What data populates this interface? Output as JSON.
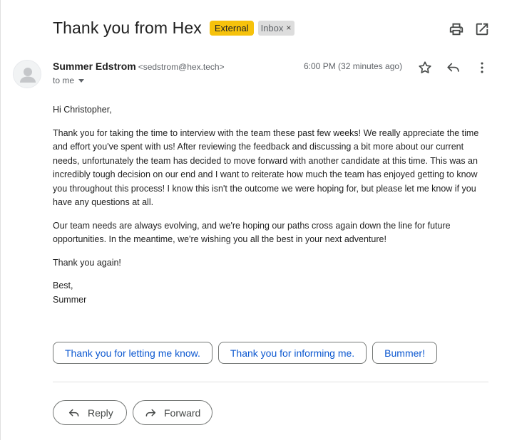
{
  "subject": "Thank you from Hex",
  "labels": {
    "external": "External",
    "inbox": "Inbox",
    "inbox_remove": "×"
  },
  "toolbar": {
    "print_icon": "print-icon",
    "open_new_window_icon": "open-in-new-window-icon"
  },
  "sender": {
    "name": "Summer Edstrom",
    "email": "<sedstrom@hex.tech>",
    "recipient": "to me",
    "time": "6:00 PM (32 minutes ago)"
  },
  "body": {
    "greeting": "Hi Christopher,",
    "paragraph1": "Thank you for taking the time to interview with the team these past few weeks! We really appreciate the time and effort you've spent with us! After reviewing the feedback and discussing a bit more about our current needs, unfortunately the team has decided to move forward with another candidate at this time. This was an incredibly tough decision on our end and I want to reiterate how much the team has enjoyed getting to know you throughout this process! I know this isn't the outcome we were hoping for, but please let me know if you have any questions at all.",
    "paragraph2": "Our team needs are always evolving, and we're hoping our paths cross again down the line for future opportunities. In the meantime, we're wishing you all the best in your next adventure!",
    "paragraph3": "Thank you again!",
    "signoff": "Best,",
    "signature": "Summer"
  },
  "smart_replies": [
    "Thank you for letting me know.",
    "Thank you for informing me.",
    "Bummer!"
  ],
  "actions": {
    "reply": "Reply",
    "forward": "Forward"
  },
  "colors": {
    "external_label": "#f6c20c",
    "inbox_label": "#dddddd",
    "link_blue": "#0b57d0"
  }
}
